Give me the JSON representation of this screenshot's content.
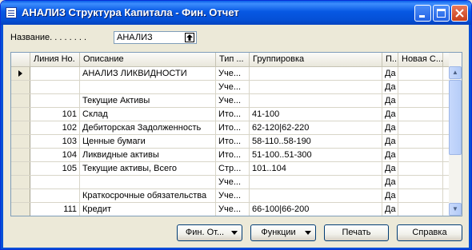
{
  "window": {
    "title": "АНАЛИЗ Структура Капитала - Фин. Отчет"
  },
  "filter": {
    "label": "Название. . . . . . . .",
    "value": "АНАЛИЗ"
  },
  "columns": [
    "Линия Но.",
    "Описание",
    "Тип ...",
    "Группировка",
    "П...",
    "Новая С..."
  ],
  "rows": [
    {
      "line": "",
      "desc": "АНАЛИЗ ЛИКВИДНОСТИ",
      "type": "Уче...",
      "group": "",
      "p": "Да",
      "new": "",
      "current": true
    },
    {
      "line": "",
      "desc": "",
      "type": "Уче...",
      "group": "",
      "p": "Да",
      "new": ""
    },
    {
      "line": "",
      "desc": "Текущие Активы",
      "type": "Уче...",
      "group": "",
      "p": "Да",
      "new": ""
    },
    {
      "line": "101",
      "desc": "Склад",
      "type": "Ито...",
      "group": "41-100",
      "p": "Да",
      "new": ""
    },
    {
      "line": "102",
      "desc": "Дебиторская Задолженность",
      "type": "Ито...",
      "group": "62-120|62-220",
      "p": "Да",
      "new": ""
    },
    {
      "line": "103",
      "desc": "Ценные бумаги",
      "type": "Ито...",
      "group": "58-110..58-190",
      "p": "Да",
      "new": ""
    },
    {
      "line": "104",
      "desc": "Ликвидные активы",
      "type": "Ито...",
      "group": "51-100..51-300",
      "p": "Да",
      "new": ""
    },
    {
      "line": "105",
      "desc": "Текущие активы, Всего",
      "type": "Стр...",
      "group": "101..104",
      "p": "Да",
      "new": ""
    },
    {
      "line": "",
      "desc": "",
      "type": "Уче...",
      "group": "",
      "p": "Да",
      "new": ""
    },
    {
      "line": "",
      "desc": "Краткосрочные обязательства",
      "type": "Уче...",
      "group": "",
      "p": "Да",
      "new": ""
    },
    {
      "line": "111",
      "desc": "Кредит",
      "type": "Уче...",
      "group": "66-100|66-200",
      "p": "Да",
      "new": ""
    }
  ],
  "buttons": {
    "fin_report": "Фин. От...",
    "functions": "Функции",
    "print": "Печать",
    "help": "Справка"
  },
  "scrollbar": {
    "up": "▲",
    "down": "▼"
  },
  "colors": {
    "title_bar": "#0550D6",
    "window_bg": "#ECE9D8"
  }
}
